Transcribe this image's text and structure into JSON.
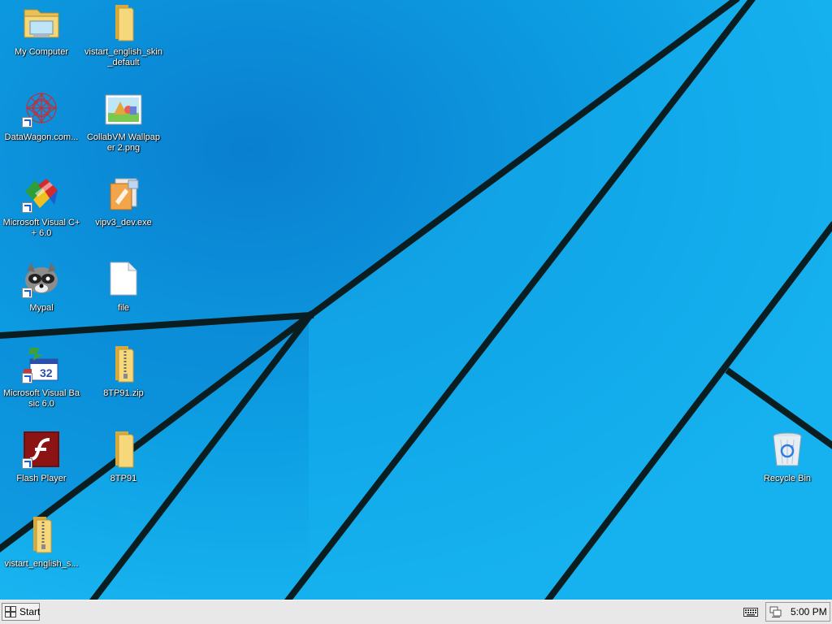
{
  "desktop": {
    "icons": [
      {
        "label": "My Computer",
        "icon": "my-computer-icon"
      },
      {
        "label": "vistart_english_skin_default",
        "icon": "folder-icon"
      },
      {
        "label": "DataWagon.com...",
        "icon": "datawagon-icon"
      },
      {
        "label": "CollabVM Wallpaper 2.png",
        "icon": "image-file-icon"
      },
      {
        "label": "Microsoft Visual C++ 6.0",
        "icon": "visual-cpp-icon"
      },
      {
        "label": "vipv3_dev.exe",
        "icon": "installer-icon"
      },
      {
        "label": "Mypal",
        "icon": "mypal-icon"
      },
      {
        "label": "file",
        "icon": "blank-file-icon"
      },
      {
        "label": "Microsoft Visual Basic 6.0",
        "icon": "visual-basic-icon"
      },
      {
        "label": "8TP91.zip",
        "icon": "zip-folder-icon"
      },
      {
        "label": "Flash Player",
        "icon": "flash-player-icon"
      },
      {
        "label": "8TP91",
        "icon": "folder-icon"
      },
      {
        "label": "vistart_english_s...",
        "icon": "zip-folder-icon"
      },
      {
        "label": "Recycle Bin",
        "icon": "recycle-bin-icon"
      }
    ]
  },
  "taskbar": {
    "start_label": "Start",
    "clock": "5:00 PM"
  },
  "colors": {
    "wallpaper": "#0a9ee0",
    "taskbar": "#e8e8e8"
  }
}
